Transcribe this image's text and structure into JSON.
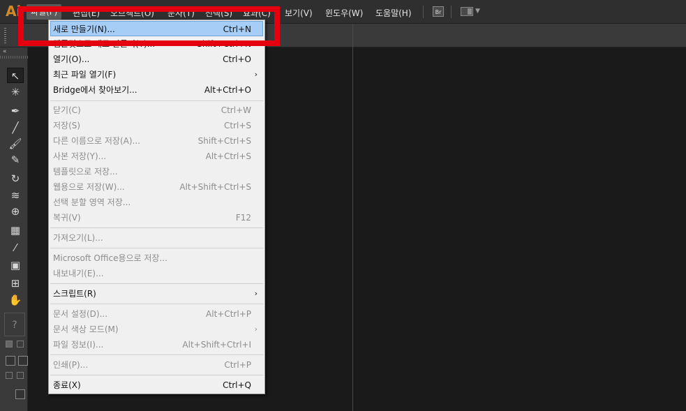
{
  "app": {
    "logo": "Ai"
  },
  "menubar": {
    "items": [
      {
        "id": "file",
        "label": "파일(F)"
      },
      {
        "id": "edit",
        "label": "편집(E)"
      },
      {
        "id": "object",
        "label": "오브젝트(O)"
      },
      {
        "id": "type",
        "label": "문자(T)"
      },
      {
        "id": "select",
        "label": "선택(S)"
      },
      {
        "id": "effect",
        "label": "효과(C)"
      },
      {
        "id": "view",
        "label": "보기(V)"
      },
      {
        "id": "window",
        "label": "윈도우(W)"
      },
      {
        "id": "help",
        "label": "도움말(H)"
      }
    ],
    "bridge_button": "Br"
  },
  "file_menu": {
    "items": [
      {
        "label": "새로 만들기(N)...",
        "shortcut": "Ctrl+N"
      },
      {
        "label": "템플릿으로 새로 만들기(T)...",
        "shortcut": "Shift+Ctrl+N"
      },
      {
        "label": "열기(O)...",
        "shortcut": "Ctrl+O"
      },
      {
        "label": "최근 파일 열기(F)",
        "shortcut": ""
      },
      {
        "label": "Bridge에서 찾아보기...",
        "shortcut": "Alt+Ctrl+O"
      },
      {
        "label": "닫기(C)",
        "shortcut": "Ctrl+W"
      },
      {
        "label": "저장(S)",
        "shortcut": "Ctrl+S"
      },
      {
        "label": "다른 이름으로 저장(A)...",
        "shortcut": "Shift+Ctrl+S"
      },
      {
        "label": "사본 저장(Y)...",
        "shortcut": "Alt+Ctrl+S"
      },
      {
        "label": "템플릿으로 저장...",
        "shortcut": ""
      },
      {
        "label": "웹용으로 저장(W)...",
        "shortcut": "Alt+Shift+Ctrl+S"
      },
      {
        "label": "선택 분할 영역 저장...",
        "shortcut": ""
      },
      {
        "label": "복귀(V)",
        "shortcut": "F12"
      },
      {
        "label": "가져오기(L)...",
        "shortcut": ""
      },
      {
        "label": "Microsoft Office용으로 저장...",
        "shortcut": ""
      },
      {
        "label": "내보내기(E)...",
        "shortcut": ""
      },
      {
        "label": "스크립트(R)",
        "shortcut": ""
      },
      {
        "label": "문서 설정(D)...",
        "shortcut": "Alt+Ctrl+P"
      },
      {
        "label": "문서 색상 모드(M)",
        "shortcut": ""
      },
      {
        "label": "파일 정보(I)...",
        "shortcut": "Alt+Shift+Ctrl+I"
      },
      {
        "label": "인쇄(P)...",
        "shortcut": "Ctrl+P"
      },
      {
        "label": "종료(X)",
        "shortcut": "Ctrl+Q"
      }
    ]
  },
  "toolbar": {
    "help_placeholder": "?"
  },
  "colors": {
    "accent_logo": "#d18a27",
    "highlight": "#a6cdf6",
    "annotation_red": "#e4000f"
  }
}
